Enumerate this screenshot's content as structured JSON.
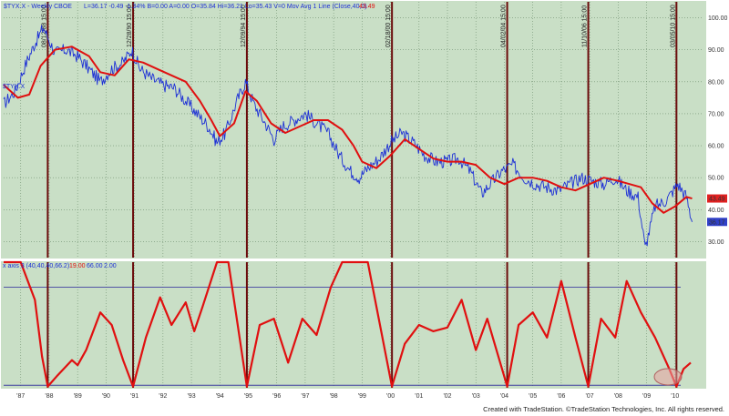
{
  "header": {
    "symbol": "$TYX.X - Weekly CBOE",
    "quote": "L=36.17  -0.49  -1.34%  B=0.00  A=0.00  O=35.84  Hi=36.21  Lo=35.43  V=0  Mov Avg 1 Line (Close,40,0)",
    "ma_value": "43.49",
    "symbol_label": "$TYX.X",
    "osc_title": "x axis 3 (40,40,40,66.2)",
    "osc_v1": "19.00",
    "osc_v2": "66.00",
    "osc_v3": "2.00"
  },
  "footer": {
    "credit": "Created with TradeStation. ©TradeStation Technologies, Inc. All rights reserved."
  },
  "colors": {
    "background": "#c9dfc6",
    "grid": "#6f8f6f",
    "price": "#1c2fd6",
    "ma": "#e01010",
    "marker": "#6b0c0c",
    "hline": "#4040a0",
    "ma_box": "#e02020",
    "price_box": "#3040c8"
  },
  "chart_data": [
    {
      "type": "line",
      "name": "price-panel",
      "x_ticks": [
        "'87",
        "'88",
        "'89",
        "'90",
        "'91",
        "'92",
        "'93",
        "'94",
        "'95",
        "'96",
        "'97",
        "'98",
        "'99",
        "'00",
        "'01",
        "'02",
        "'03",
        "'04",
        "'05",
        "'06",
        "'07",
        "'08",
        "'09",
        "'10"
      ],
      "y_ticks": [
        "100.00",
        "90.00",
        "80.00",
        "70.00",
        "60.00",
        "50.00",
        "40.00",
        "30.00"
      ],
      "ylim": [
        25,
        105
      ],
      "xlim": [
        1986.4,
        2011.0
      ],
      "last_close_label": "36.17",
      "last_ma_label": "43.49",
      "series": [
        {
          "name": "$TYX.X",
          "x": [
            1986.4,
            1986.8,
            1987.2,
            1987.5,
            1987.8,
            1988.2,
            1988.6,
            1989.0,
            1989.4,
            1989.8,
            1990.2,
            1990.6,
            1990.9,
            1991.2,
            1991.6,
            1992.0,
            1992.4,
            1992.8,
            1993.2,
            1993.6,
            1993.9,
            1994.2,
            1994.6,
            1994.9,
            1995.2,
            1995.6,
            1995.9,
            1996.2,
            1996.6,
            1997.0,
            1997.4,
            1997.8,
            1998.2,
            1998.6,
            1998.9,
            1999.2,
            1999.6,
            2000.0,
            2000.4,
            2000.8,
            2001.2,
            2001.6,
            2002.0,
            2002.4,
            2002.8,
            2003.2,
            2003.5,
            2003.9,
            2004.3,
            2004.7,
            2005.1,
            2005.5,
            2005.9,
            2006.3,
            2006.7,
            2007.1,
            2007.5,
            2007.9,
            2008.3,
            2008.7,
            2008.95,
            2009.3,
            2009.7,
            2010.1,
            2010.4,
            2010.6
          ],
          "values": [
            73,
            77,
            86,
            92,
            97,
            89,
            90,
            88,
            84,
            80,
            84,
            86,
            90,
            84,
            81,
            79,
            78,
            74,
            70,
            66,
            61,
            64,
            74,
            80,
            73,
            67,
            62,
            66,
            68,
            70,
            67,
            64,
            57,
            52,
            50,
            53,
            56,
            61,
            64,
            61,
            57,
            55,
            55,
            56,
            52,
            45,
            48,
            52,
            54,
            50,
            48,
            47,
            46,
            48,
            50,
            49,
            48,
            50,
            46,
            44,
            28,
            41,
            43,
            48,
            44,
            36.17
          ]
        },
        {
          "name": "Mov Avg 1 Line (Close,40,0)",
          "x": [
            1986.4,
            1986.9,
            1987.3,
            1987.7,
            1988.2,
            1988.8,
            1989.4,
            1989.8,
            1990.3,
            1990.8,
            1991.3,
            1991.8,
            1992.3,
            1992.8,
            1993.3,
            1993.7,
            1994.0,
            1994.5,
            1994.9,
            1995.3,
            1995.8,
            1996.3,
            1996.8,
            1997.3,
            1997.8,
            1998.3,
            1998.7,
            1999.0,
            1999.5,
            2000.0,
            2000.5,
            2001.0,
            2001.5,
            2002.0,
            2002.5,
            2003.0,
            2003.5,
            2004.0,
            2004.5,
            2005.0,
            2005.5,
            2006.0,
            2006.5,
            2007.0,
            2007.5,
            2008.0,
            2008.4,
            2008.8,
            2009.2,
            2009.6,
            2010.0,
            2010.4,
            2010.6
          ],
          "values": [
            79,
            75,
            76,
            85,
            90,
            91,
            88,
            83,
            82,
            87,
            86,
            84,
            82,
            80,
            74,
            68,
            63,
            67,
            77,
            74,
            67,
            64,
            66,
            68,
            68,
            65,
            60,
            55,
            53,
            57,
            62,
            59,
            56,
            55,
            55,
            54,
            50,
            48,
            50,
            50,
            49,
            47,
            46,
            48,
            50,
            49,
            48,
            47,
            42,
            39,
            41,
            44,
            43.49
          ]
        }
      ]
    },
    {
      "type": "line",
      "name": "oscillator-panel",
      "x_ticks": [
        "'87",
        "'88",
        "'89",
        "'90",
        "'91",
        "'92",
        "'93",
        "'94",
        "'95",
        "'96",
        "'97",
        "'98",
        "'99",
        "'00",
        "'01",
        "'02",
        "'03",
        "'04",
        "'05",
        "'06",
        "'07",
        "'08",
        "'09",
        "'10"
      ],
      "ylim": [
        0,
        100
      ],
      "upper_level": 80,
      "lower_level": 2,
      "series": [
        {
          "name": "x axis 3",
          "x": [
            1986.4,
            1987.0,
            1987.5,
            1987.75,
            1987.95,
            1988.3,
            1988.8,
            1989.0,
            1989.3,
            1989.8,
            1990.2,
            1990.6,
            1990.95,
            1991.4,
            1991.9,
            1992.3,
            1992.8,
            1993.1,
            1993.4,
            1993.9,
            1994.3,
            1994.95,
            1995.4,
            1995.9,
            1996.4,
            1996.9,
            1997.4,
            1997.9,
            1998.3,
            1998.8,
            1999.2,
            2000.05,
            2000.5,
            2001.0,
            2001.5,
            2002.0,
            2002.5,
            2003.0,
            2003.4,
            2004.1,
            2004.5,
            2005.0,
            2005.5,
            2006.0,
            2006.5,
            2006.95,
            2007.4,
            2007.9,
            2008.3,
            2008.8,
            2009.3,
            2009.8,
            2010.05,
            2010.3,
            2010.55
          ],
          "values": [
            100,
            100,
            70,
            25,
            1,
            10,
            22,
            18,
            30,
            60,
            50,
            22,
            1,
            40,
            72,
            50,
            68,
            45,
            65,
            100,
            100,
            1,
            50,
            55,
            20,
            55,
            42,
            80,
            100,
            100,
            100,
            1,
            35,
            50,
            45,
            48,
            70,
            30,
            55,
            1,
            50,
            60,
            40,
            85,
            40,
            1,
            55,
            40,
            85,
            60,
            40,
            15,
            1,
            15,
            20
          ]
        }
      ]
    }
  ],
  "markers": {
    "x": [
      1987.95,
      1990.95,
      1994.95,
      2000.05,
      2004.1,
      2006.95,
      2010.05
    ],
    "labels": [
      "08/12/88 15:00",
      "12/28/90 15:00",
      "12/09/94 15:00",
      "02/18/00 15:00",
      "04/02/04 15:00",
      "11/10/06 15:00",
      "03/05/10 15:00"
    ]
  }
}
